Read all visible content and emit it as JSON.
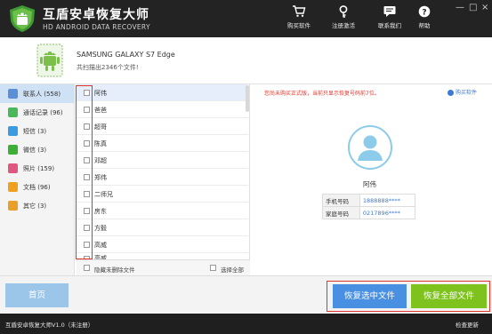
{
  "header": {
    "title": "互盾安卓恢复大师",
    "subtitle": "HD ANDROID DATA RECOVERY",
    "toolbar": [
      {
        "label": "购买软件",
        "icon": "cart-icon"
      },
      {
        "label": "注册激活",
        "icon": "key-icon"
      },
      {
        "label": "联系我们",
        "icon": "chat-icon"
      },
      {
        "label": "帮助",
        "icon": "help-icon"
      }
    ],
    "window_controls": {
      "minimize": "—",
      "maximize": "□",
      "close": "×"
    }
  },
  "device": {
    "name": "SAMSUNG GALAXY S7 Edge",
    "scan_result": "共扫描出2346个文件!"
  },
  "categories": [
    {
      "label": "联系人 (558)",
      "icon": "contacts-icon",
      "color": "#5b8fd6"
    },
    {
      "label": "通话记录 (96)",
      "icon": "phone-icon",
      "color": "#49b85a"
    },
    {
      "label": "短信 (3)",
      "icon": "sms-icon",
      "color": "#3a9be0"
    },
    {
      "label": "微信 (3)",
      "icon": "wechat-icon",
      "color": "#3cb035"
    },
    {
      "label": "照片 (159)",
      "icon": "photo-icon",
      "color": "#e05780"
    },
    {
      "label": "文档 (96)",
      "icon": "document-icon",
      "color": "#f0a020"
    },
    {
      "label": "其它 (3)",
      "icon": "other-icon",
      "color": "#e8a02a"
    }
  ],
  "contacts": [
    "阿伟",
    "爸爸",
    "超哥",
    "陈真",
    "邓超",
    "郑伟",
    "二师兄",
    "房东",
    "方毅",
    "高威",
    "高威"
  ],
  "list_footer": {
    "hide_deleted": "隐藏未删除文件",
    "select_all": "选择全部"
  },
  "detail": {
    "notice": "您尚未购买正式版，当前只显示恢复号码前7位。",
    "buy_link": "购买软件",
    "contact_name": "阿伟",
    "fields": [
      {
        "label": "手机号码",
        "value": "1888888****"
      },
      {
        "label": "家庭号码",
        "value": "0217896****"
      }
    ]
  },
  "bottom": {
    "home": "首页",
    "recover_selected": "恢复选中文件",
    "recover_all": "恢复全部文件"
  },
  "status": {
    "left": "互盾安卓恢复大师V1.0（未注册）",
    "right": "检查更新"
  },
  "colors": {
    "header_bg": "#232323",
    "accent_red": "#e0352b",
    "blue_button": "#4a90e2",
    "green_button": "#7ec21e",
    "home_button": "#9cc5ea",
    "link_blue": "#3a7bd5",
    "selected_row": "#e6eefb"
  }
}
